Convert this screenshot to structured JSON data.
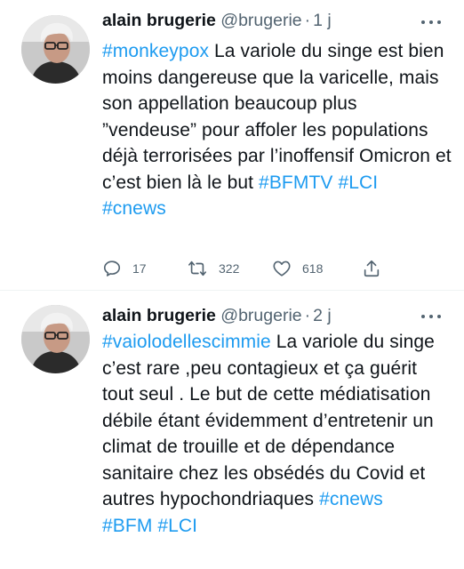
{
  "tweets": [
    {
      "author": {
        "name": "alain brugerie",
        "handle": "@brugerie",
        "time": "1 j"
      },
      "text_parts": [
        {
          "text": "#monkeypox",
          "type": "hashtag"
        },
        {
          "text": " La variole du singe est bien moins dangereuse que la varicelle, mais son appellation beaucoup plus ”vendeuse” pour affoler les populations déjà terrorisées par l’inoffensif Omicron et c’est bien là le but ",
          "type": "text"
        },
        {
          "text": "#BFMTV",
          "type": "hashtag"
        },
        {
          "text": " ",
          "type": "text"
        },
        {
          "text": "#LCI",
          "type": "hashtag"
        },
        {
          "text": " ",
          "type": "text"
        },
        {
          "text": "#cnews",
          "type": "hashtag"
        }
      ],
      "actions": {
        "replies": "17",
        "retweets": "322",
        "likes": "618"
      }
    },
    {
      "author": {
        "name": "alain brugerie",
        "handle": "@brugerie",
        "time": "2 j"
      },
      "text_parts": [
        {
          "text": "#vaiolodellescimmie",
          "type": "hashtag"
        },
        {
          "text": " La variole du singe c’est rare ,peu contagieux et ça guérit tout seul . Le but de cette médiatisation débile étant évidemment d’entretenir un climat de trouille et de dépendance sanitaire chez les obsédés du Covid et autres hypochondriaques ",
          "type": "text"
        },
        {
          "text": "#cnews",
          "type": "hashtag"
        },
        {
          "text": " ",
          "type": "text"
        },
        {
          "text": "#BFM",
          "type": "hashtag"
        },
        {
          "text": " ",
          "type": "text"
        },
        {
          "text": "#LCI",
          "type": "hashtag"
        }
      ]
    }
  ],
  "separator": "·",
  "icons": {
    "reply": "reply-icon",
    "retweet": "retweet-icon",
    "like": "like-icon",
    "share": "share-icon",
    "more": "more-icon"
  },
  "colors": {
    "link": "#1d9bf0",
    "secondary": "#536471",
    "text": "#0f1419",
    "divider": "#eff3f4"
  }
}
